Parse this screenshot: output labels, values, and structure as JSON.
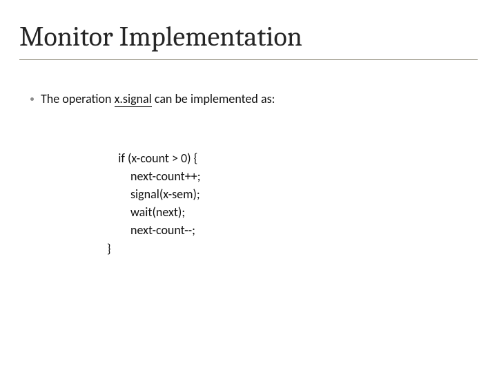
{
  "title": "Monitor Implementation",
  "bullet": {
    "prefix": "The operation ",
    "op": "x.signal",
    "suffix": " can be implemented as:"
  },
  "code": {
    "l1": "if (x-count > 0) {",
    "l2": "next-count++;",
    "l3": "signal(x-sem);",
    "l4": "wait(next);",
    "l5": "next-count--;",
    "l6": "}"
  }
}
